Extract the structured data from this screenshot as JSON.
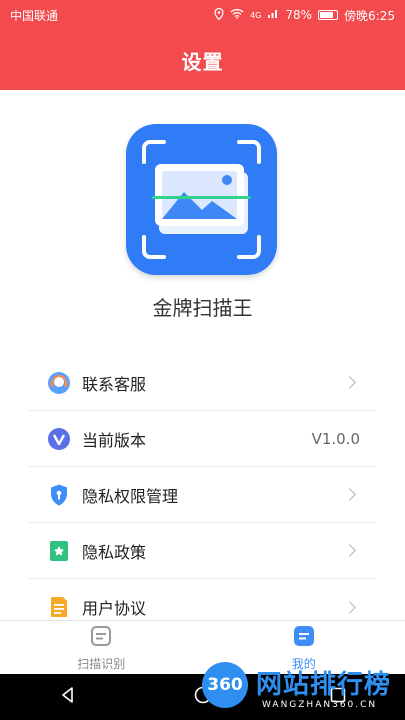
{
  "status_bar": {
    "carrier": "中国联通",
    "battery": "78%",
    "time": "傍晚6:25",
    "network": "4G"
  },
  "header": {
    "title": "设置"
  },
  "app": {
    "name": "金牌扫描王"
  },
  "menu": [
    {
      "label": "联系客服",
      "icon": "headset-icon"
    },
    {
      "label": "当前版本",
      "icon": "version-icon",
      "value": "V1.0.0"
    },
    {
      "label": "隐私权限管理",
      "icon": "shield-icon"
    },
    {
      "label": "隐私政策",
      "icon": "bookmark-icon"
    },
    {
      "label": "用户协议",
      "icon": "document-icon"
    }
  ],
  "tabs": [
    {
      "label": "扫描识别",
      "active": false
    },
    {
      "label": "我的",
      "active": true
    }
  ],
  "watermark": {
    "logo": "360",
    "brand": "网站排行榜",
    "url": "WANGZHAN360.CN"
  },
  "colors": {
    "brand_red": "#f24a4d",
    "accent_blue": "#2f7cf6"
  }
}
